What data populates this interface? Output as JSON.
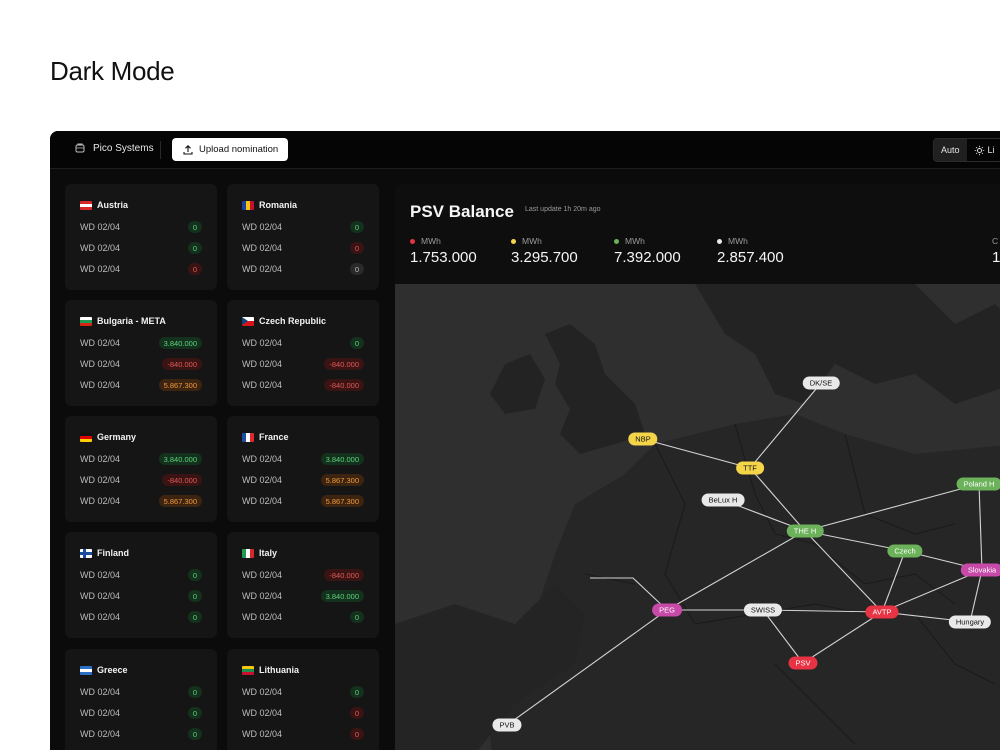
{
  "page": {
    "heading": "Dark Mode"
  },
  "topbar": {
    "brand": "Pico Systems",
    "upload_label": "Upload nomination",
    "mode_auto": "Auto",
    "mode_light": "Li"
  },
  "cards": [
    {
      "name": "Austria",
      "flag": [
        "#d62828",
        "#ffffff",
        "#d62828"
      ],
      "flag_dir": "v",
      "rows": [
        {
          "label": "WD 02/04",
          "value": "0",
          "tone": "green"
        },
        {
          "label": "WD 02/04",
          "value": "0",
          "tone": "green"
        },
        {
          "label": "WD 02/04",
          "value": "0",
          "tone": "red"
        }
      ]
    },
    {
      "name": "Romania",
      "flag": [
        "#1d3f9b",
        "#f3c614",
        "#c8102e"
      ],
      "flag_dir": "h",
      "rows": [
        {
          "label": "WD 02/04",
          "value": "0",
          "tone": "green"
        },
        {
          "label": "WD 02/04",
          "value": "0",
          "tone": "red"
        },
        {
          "label": "WD 02/04",
          "value": "0",
          "tone": "grey"
        }
      ]
    },
    {
      "name": "Bulgaria - META",
      "flag": [
        "#ffffff",
        "#1f9b55",
        "#d62612"
      ],
      "flag_dir": "v",
      "rows": [
        {
          "label": "WD 02/04",
          "value": "3.840.000",
          "tone": "green"
        },
        {
          "label": "WD 02/04",
          "value": "-840.000",
          "tone": "red"
        },
        {
          "label": "WD 02/04",
          "value": "5.867.300",
          "tone": "orange"
        }
      ]
    },
    {
      "name": "Czech Republic",
      "flag": [
        "#ffffff",
        "#d7141a",
        "#11457e"
      ],
      "flag_dir": "cz",
      "rows": [
        {
          "label": "WD 02/04",
          "value": "0",
          "tone": "green"
        },
        {
          "label": "WD 02/04",
          "value": "-840.000",
          "tone": "red"
        },
        {
          "label": "WD 02/04",
          "value": "-840.000",
          "tone": "red"
        }
      ]
    },
    {
      "name": "Germany",
      "flag": [
        "#111111",
        "#dd0000",
        "#ffce00"
      ],
      "flag_dir": "v",
      "rows": [
        {
          "label": "WD 02/04",
          "value": "3.840.000",
          "tone": "green"
        },
        {
          "label": "WD 02/04",
          "value": "-840.000",
          "tone": "red"
        },
        {
          "label": "WD 02/04",
          "value": "5.867.300",
          "tone": "orange"
        }
      ]
    },
    {
      "name": "France",
      "flag": [
        "#1e4ea1",
        "#ffffff",
        "#e1262d"
      ],
      "flag_dir": "h",
      "rows": [
        {
          "label": "WD 02/04",
          "value": "3.840.000",
          "tone": "green"
        },
        {
          "label": "WD 02/04",
          "value": "5.867.300",
          "tone": "orange"
        },
        {
          "label": "WD 02/04",
          "value": "5.867.300",
          "tone": "orange"
        }
      ]
    },
    {
      "name": "Finland",
      "flag": [
        "#ffffff",
        "#1a4fa0",
        "#ffffff"
      ],
      "flag_dir": "fi",
      "rows": [
        {
          "label": "WD 02/04",
          "value": "0",
          "tone": "green"
        },
        {
          "label": "WD 02/04",
          "value": "0",
          "tone": "green"
        },
        {
          "label": "WD 02/04",
          "value": "0",
          "tone": "green"
        }
      ]
    },
    {
      "name": "Italy",
      "flag": [
        "#1f9b55",
        "#ffffff",
        "#d62828"
      ],
      "flag_dir": "h",
      "rows": [
        {
          "label": "WD 02/04",
          "value": "-840.000",
          "tone": "red"
        },
        {
          "label": "WD 02/04",
          "value": "3.840.000",
          "tone": "green"
        },
        {
          "label": "WD 02/04",
          "value": "0",
          "tone": "green"
        }
      ]
    },
    {
      "name": "Greece",
      "flag": [
        "#2d6fc4",
        "#ffffff",
        "#2d6fc4"
      ],
      "flag_dir": "v",
      "rows": [
        {
          "label": "WD 02/04",
          "value": "0",
          "tone": "green"
        },
        {
          "label": "WD 02/04",
          "value": "0",
          "tone": "green"
        },
        {
          "label": "WD 02/04",
          "value": "0",
          "tone": "green"
        }
      ]
    },
    {
      "name": "Lithuania",
      "flag": [
        "#f3c614",
        "#1f8a4c",
        "#c8102e"
      ],
      "flag_dir": "v",
      "rows": [
        {
          "label": "WD 02/04",
          "value": "0",
          "tone": "green"
        },
        {
          "label": "WD 02/04",
          "value": "0",
          "tone": "red"
        },
        {
          "label": "WD 02/04",
          "value": "0",
          "tone": "red"
        }
      ]
    }
  ],
  "panel": {
    "title": "PSV Balance",
    "last_update": "Last update 1h 20m ago",
    "stats": [
      {
        "unit": "MWh",
        "value": "1.753.000",
        "color": "#e73344"
      },
      {
        "unit": "MWh",
        "value": "3.295.700",
        "color": "#f4d54a"
      },
      {
        "unit": "MWh",
        "value": "7.392.000",
        "color": "#6bb25a"
      },
      {
        "unit": "MWh",
        "value": "2.857.400",
        "color": "#e9e9e9"
      },
      {
        "unit": "C",
        "value": "1",
        "color": ""
      }
    ]
  },
  "map": {
    "nodes": [
      {
        "id": "dkse",
        "label": "DK/SE",
        "tone": "white"
      },
      {
        "id": "nbp",
        "label": "NBP",
        "tone": "yellow"
      },
      {
        "id": "ttf",
        "label": "TTF",
        "tone": "yellow"
      },
      {
        "id": "belux",
        "label": "BeLux H",
        "tone": "white"
      },
      {
        "id": "polandh",
        "label": "Poland H",
        "tone": "green"
      },
      {
        "id": "theh",
        "label": "THE H",
        "tone": "green"
      },
      {
        "id": "czech",
        "label": "Czech",
        "tone": "green"
      },
      {
        "id": "slovakia",
        "label": "Slovakia",
        "tone": "pink"
      },
      {
        "id": "peg",
        "label": "PEG",
        "tone": "pink"
      },
      {
        "id": "swiss",
        "label": "SWISS",
        "tone": "white"
      },
      {
        "id": "avtp",
        "label": "AVTP",
        "tone": "red"
      },
      {
        "id": "hungary",
        "label": "Hungary",
        "tone": "white"
      },
      {
        "id": "psv",
        "label": "PSV",
        "tone": "red"
      },
      {
        "id": "pvb",
        "label": "PVB",
        "tone": "white"
      }
    ],
    "edges": [
      [
        "dkse",
        "ttf"
      ],
      [
        "nbp",
        "ttf"
      ],
      [
        "ttf",
        "theh"
      ],
      [
        "belux",
        "theh"
      ],
      [
        "theh",
        "polandh"
      ],
      [
        "theh",
        "czech"
      ],
      [
        "theh",
        "peg"
      ],
      [
        "theh",
        "avtp"
      ],
      [
        "czech",
        "slovakia"
      ],
      [
        "czech",
        "avtp"
      ],
      [
        "peg",
        "swiss"
      ],
      [
        "swiss",
        "avtp"
      ],
      [
        "swiss",
        "psv"
      ],
      [
        "avtp",
        "psv"
      ],
      [
        "avtp",
        "slovakia"
      ],
      [
        "avtp",
        "hungary"
      ],
      [
        "slovakia",
        "hungary"
      ],
      [
        "slovakia",
        "polandh"
      ],
      [
        "peg",
        "pvb"
      ]
    ]
  }
}
